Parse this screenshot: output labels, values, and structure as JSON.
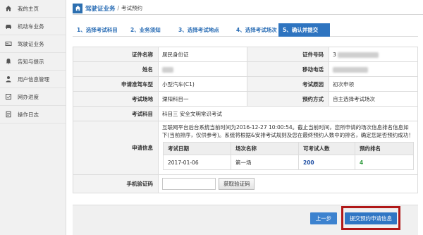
{
  "sidebar": {
    "items": [
      {
        "label": "我的主页",
        "icon": "home-icon"
      },
      {
        "label": "机动车业务",
        "icon": "car-icon"
      },
      {
        "label": "驾驶证业务",
        "icon": "license-card-icon"
      },
      {
        "label": "告知与提示",
        "icon": "bell-icon"
      },
      {
        "label": "用户信息管理",
        "icon": "user-icon"
      },
      {
        "label": "网办进度",
        "icon": "progress-icon"
      },
      {
        "label": "操作日志",
        "icon": "log-icon"
      }
    ]
  },
  "breadcrumb": {
    "section": "驾驶证业务",
    "separator": "/",
    "page": "考试预约"
  },
  "steps": [
    {
      "label": "1、选择考试科目",
      "active": false
    },
    {
      "label": "2、业务须知",
      "active": false
    },
    {
      "label": "3、选择考试地点",
      "active": false
    },
    {
      "label": "4、选择考试场次",
      "active": false
    },
    {
      "label": "5、确认并提交",
      "active": true
    }
  ],
  "form": {
    "id_type_label": "证件名称",
    "id_type_value": "居民身份证",
    "id_number_label": "证件号码",
    "id_number_prefix": "3",
    "name_label": "姓名",
    "phone_label": "移动电话",
    "vehicle_type_label": "申请准驾车型",
    "vehicle_type_value": "小型汽车(C1)",
    "exam_reason_label": "考试原因",
    "exam_reason_value": "初次申领",
    "venue_label": "考试场地",
    "venue_value": "溧阳科目一",
    "booking_mode_label": "预约方式",
    "booking_mode_value": "自主选择考试场次",
    "subject_label": "考试科目",
    "subject_value": "科目三 安全文明常识考试",
    "apply_info_label": "申请信息",
    "apply_info_text": "互联网平台后台系统当前时间为2016-12-27 10:00:54。截止当前时间，您所申请的场次信息排名信息如下(当前排序，仅供参考)。系统将根据&安排考试规则及您在最终预约人数中的排名，确定您是否预约成功！",
    "sessions_table": {
      "headers": [
        "考试日期",
        "场次名称",
        "可考试人数",
        "预约排名"
      ],
      "rows": [
        {
          "date": "2017-01-06",
          "session": "第一场",
          "capacity": "200",
          "rank": "4"
        }
      ]
    },
    "sms_code_label": "手机验证码",
    "sms_code_value": "",
    "get_code_button": "获取验证码"
  },
  "footer": {
    "prev_button": "上一步",
    "submit_button": "提交预约申请信息",
    "highlight_color": "#b01818"
  },
  "colors": {
    "accent": "#2e74c0",
    "rank_green": "#2e9a3c",
    "capacity_blue": "#1f4fa3"
  }
}
